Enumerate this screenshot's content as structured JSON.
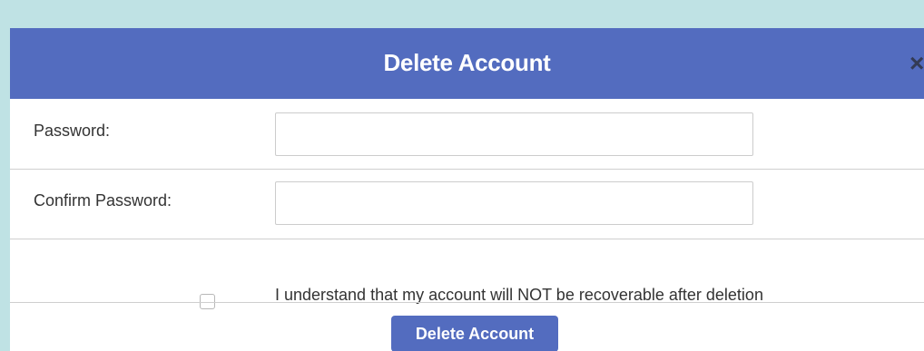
{
  "modal": {
    "title": "Delete Account",
    "close_symbol": "×",
    "close_icon": "close-icon"
  },
  "form": {
    "password_label": "Password:",
    "password_value": "",
    "password_placeholder": "",
    "confirm_label": "Confirm Password:",
    "confirm_value": "",
    "confirm_placeholder": "",
    "acknowledge_checked": false,
    "acknowledge_text": "I understand that my account will NOT be recoverable after deletion",
    "submit_label": "Delete Account"
  },
  "colors": {
    "background": "#bfe2e4",
    "header": "#536cbf",
    "button": "#536cbf",
    "divider": "#cfcfcf",
    "text": "#333333"
  }
}
